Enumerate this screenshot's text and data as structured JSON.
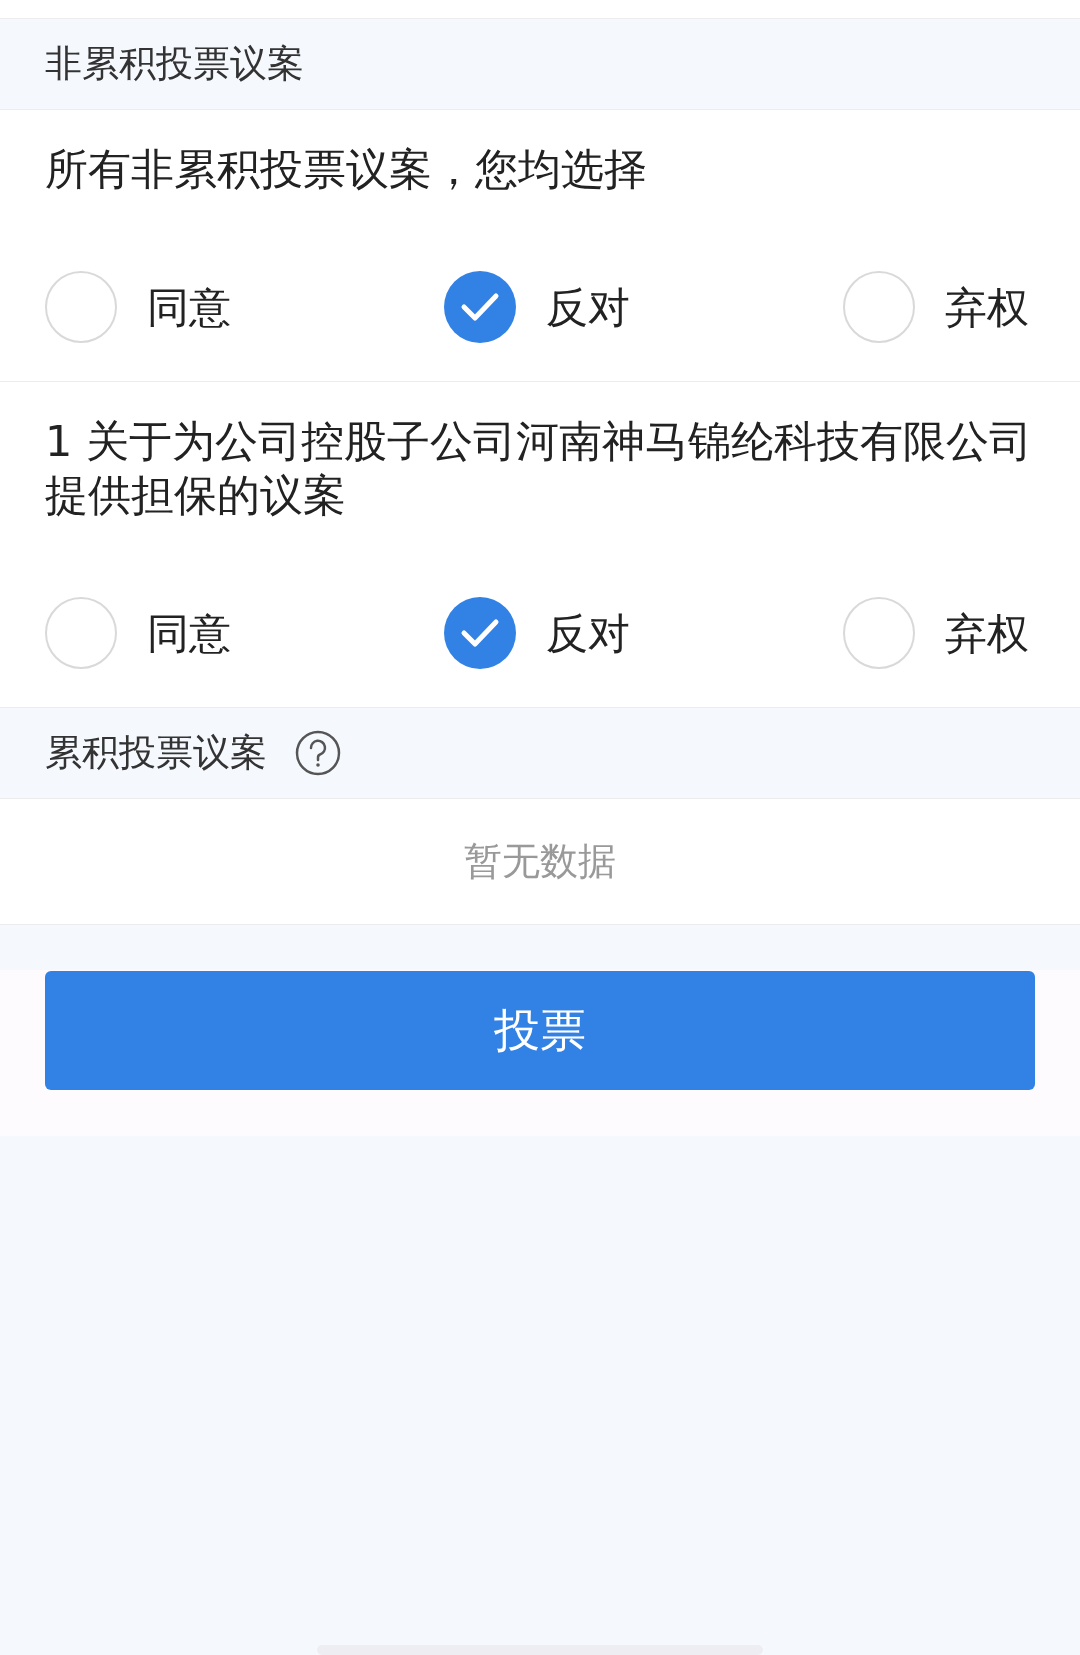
{
  "sections": [
    {
      "kind": "non_cumulative",
      "header": "非累积投票议案",
      "items": [
        {
          "title": "所有非累积投票议案，您均选择",
          "options": [
            {
              "label": "同意",
              "selected": false
            },
            {
              "label": "反对",
              "selected": true
            },
            {
              "label": "弃权",
              "selected": false
            }
          ]
        },
        {
          "title": "1 关于为公司控股子公司河南神马锦纶科技有限公司提供担保的议案",
          "options": [
            {
              "label": "同意",
              "selected": false
            },
            {
              "label": "反对",
              "selected": true
            },
            {
              "label": "弃权",
              "selected": false
            }
          ]
        }
      ]
    },
    {
      "kind": "cumulative",
      "header": "累积投票议案",
      "empty_text": "暂无数据"
    }
  ],
  "vote_button": "投票"
}
